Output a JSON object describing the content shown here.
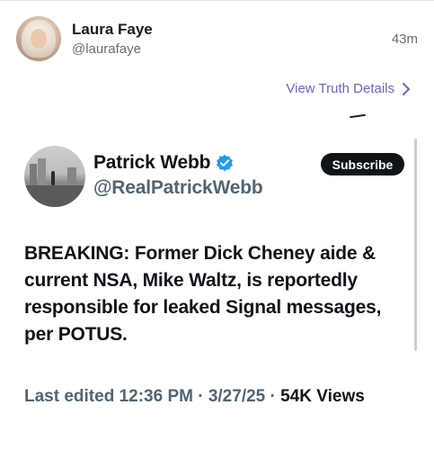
{
  "post": {
    "author_name": "Laura Faye",
    "author_handle": "@laurafaye",
    "time": "43m",
    "view_details_label": "View Truth Details"
  },
  "embed": {
    "name": "Patrick Webb",
    "handle": "@RealPatrickWebb",
    "subscribe_label": "Subscribe",
    "text": "BREAKING: Former Dick Cheney aide & current NSA, Mike Waltz, is reportedly responsible for leaked Signal messages, per POTUS.",
    "meta_prefix": "Last edited 12:36 PM · 3/27/25 ·",
    "views_count": "54K",
    "views_label": "Views"
  },
  "colors": {
    "link_purple": "#6b63c9",
    "verified_blue": "#1d9bf0",
    "button_dark": "#0f1419",
    "muted_gray": "#536471"
  }
}
